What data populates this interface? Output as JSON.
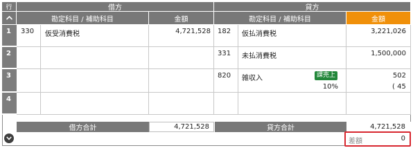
{
  "header": {
    "row_label": "行",
    "debit_title": "借方",
    "credit_title": "貸方",
    "account_col": "勘定科目 / 補助科目",
    "amount_col": "金額"
  },
  "rows": [
    {
      "num": "1",
      "debit": {
        "code": "330",
        "name": "仮受消費税",
        "amount": "4,721,528"
      },
      "credit": {
        "code": "182",
        "name": "仮払消費税",
        "amount": "3,221,026"
      }
    },
    {
      "num": "2",
      "debit": {
        "code": "",
        "name": "",
        "amount": ""
      },
      "credit": {
        "code": "331",
        "name": "未払消費税",
        "amount": "1,500,000"
      }
    },
    {
      "num": "3",
      "debit": {
        "code": "",
        "name": "",
        "amount": ""
      },
      "credit": {
        "code": "820",
        "name": "雑収入",
        "amount": "502",
        "badge": "課売上",
        "rate": "10%",
        "tax": "( 45"
      }
    },
    {
      "num": "4",
      "debit": {
        "code": "",
        "name": "",
        "amount": ""
      },
      "credit": {
        "code": "",
        "name": "",
        "amount": ""
      }
    }
  ],
  "footer": {
    "debit_total_label": "借方合計",
    "debit_total": "4,721,528",
    "credit_total_label": "貸方合計",
    "credit_total": "4,721,528",
    "diff_label": "差額",
    "diff_value": "0"
  },
  "colors": {
    "header_gray": "#787878",
    "accent_orange": "#f0900a",
    "badge_green": "#22873a",
    "highlight_red": "#d7262e"
  },
  "icons": {
    "scroll_up": "chevron-up-icon",
    "expand": "chevron-down-icon"
  }
}
